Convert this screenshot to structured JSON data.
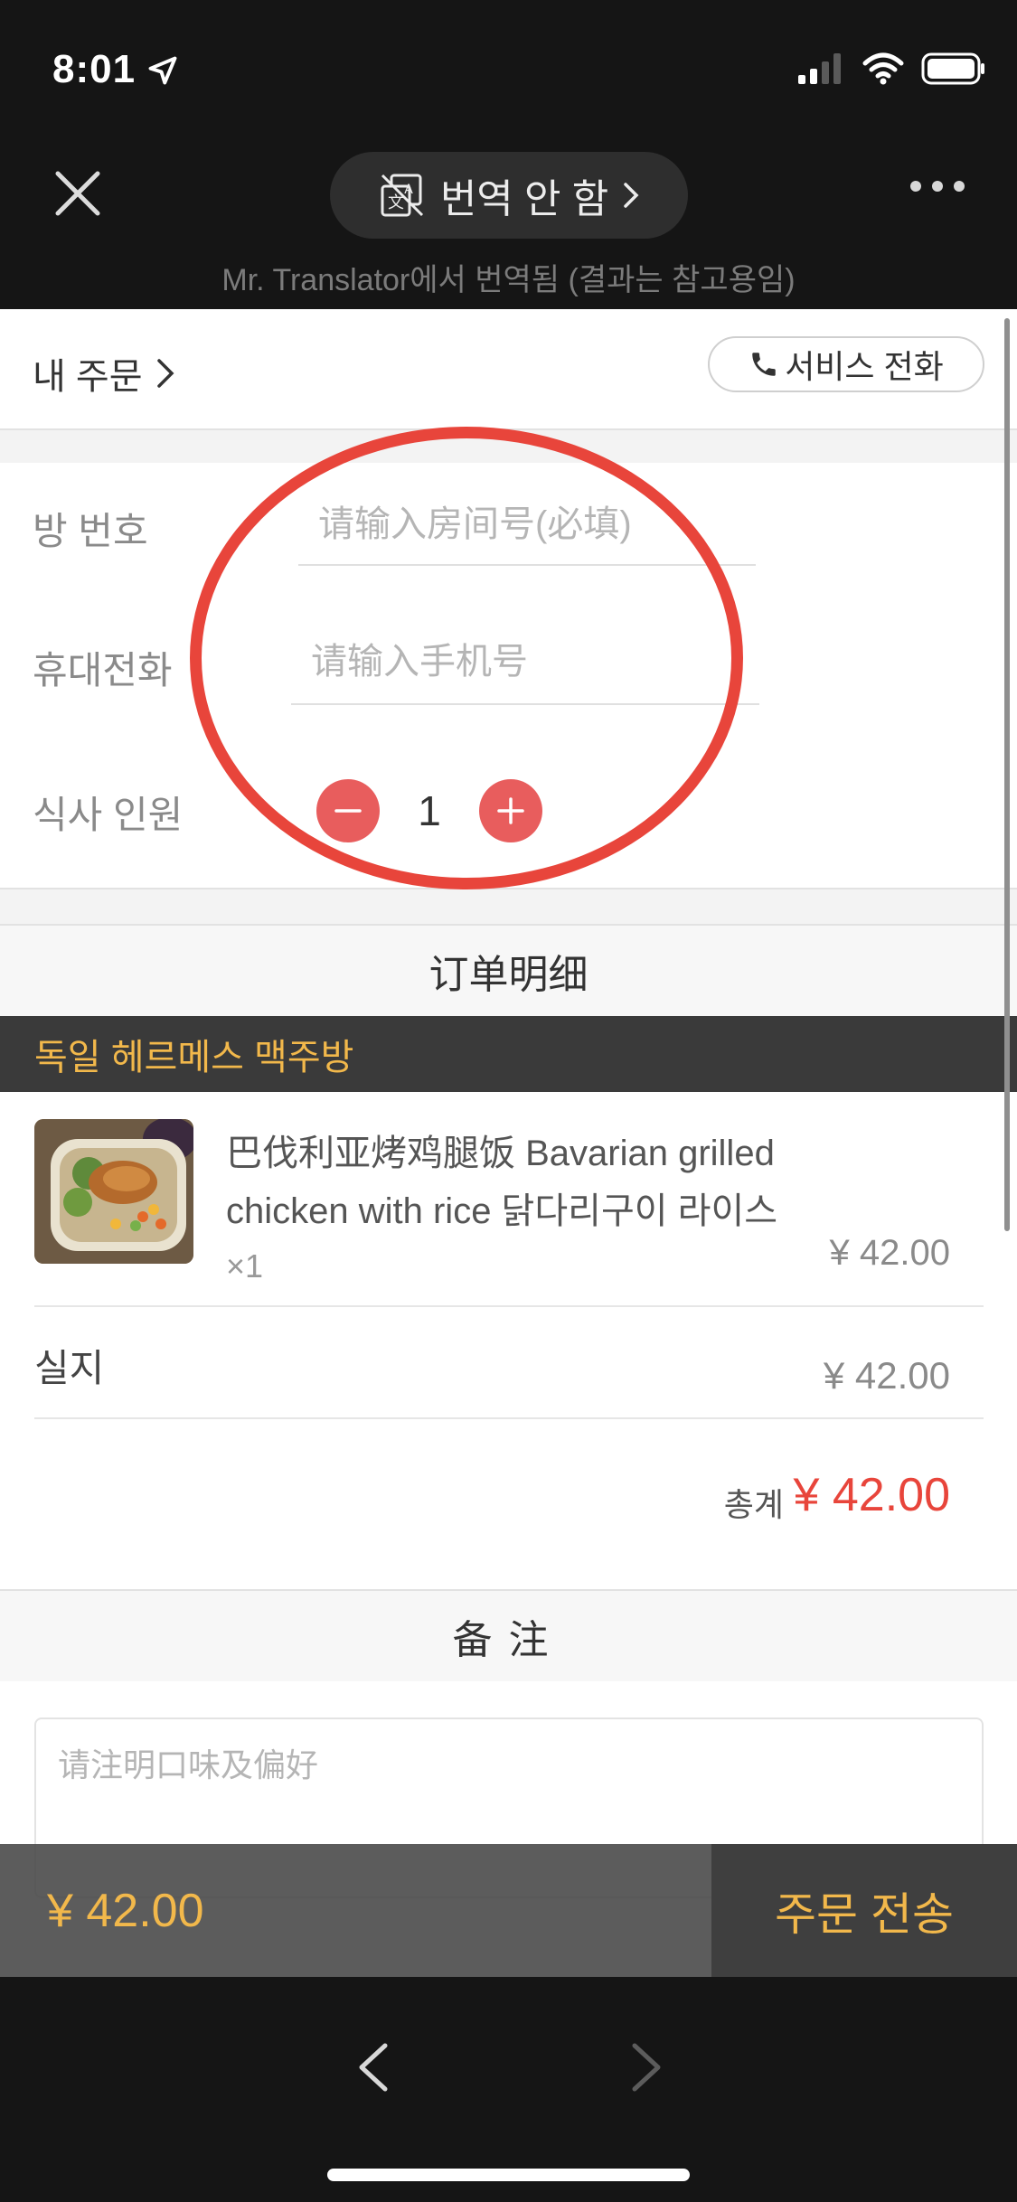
{
  "status": {
    "time": "8:01"
  },
  "browser": {
    "translate_label": "번역 안 함",
    "translation_note": "Mr. Translator에서 번역됨 (결과는 참고용임)"
  },
  "header": {
    "my_order": "내 주문",
    "service_call": "서비스 전화"
  },
  "form": {
    "room_label": "방 번호",
    "room_placeholder": "请输入房间号(必填)",
    "phone_label": "휴대전화",
    "phone_placeholder": "请输入手机号",
    "diners_label": "식사 인원",
    "diners_count": "1"
  },
  "order_detail": {
    "title": "订单明细",
    "shop_name": "독일 헤르메스 맥주방",
    "items": [
      {
        "name": "巴伐利亚烤鸡腿饭 Bavarian grilled chicken with rice 닭다리구이 라이스",
        "qty": "×1",
        "price": "¥ 42.00"
      }
    ],
    "paid_label": "실지",
    "paid_value": "¥ 42.00",
    "total_label": "총계",
    "total_value": "¥ 42.00"
  },
  "remark": {
    "title": "备注",
    "placeholder": "请注明口味及偏好"
  },
  "bottom_bar": {
    "price": "¥ 42.00",
    "submit_label": "주문 전송"
  },
  "colors": {
    "accent_red": "#e8453b",
    "stepper_red": "#e85d5d",
    "gold": "#f2b84b",
    "dark_bar": "#3a3a3a"
  }
}
